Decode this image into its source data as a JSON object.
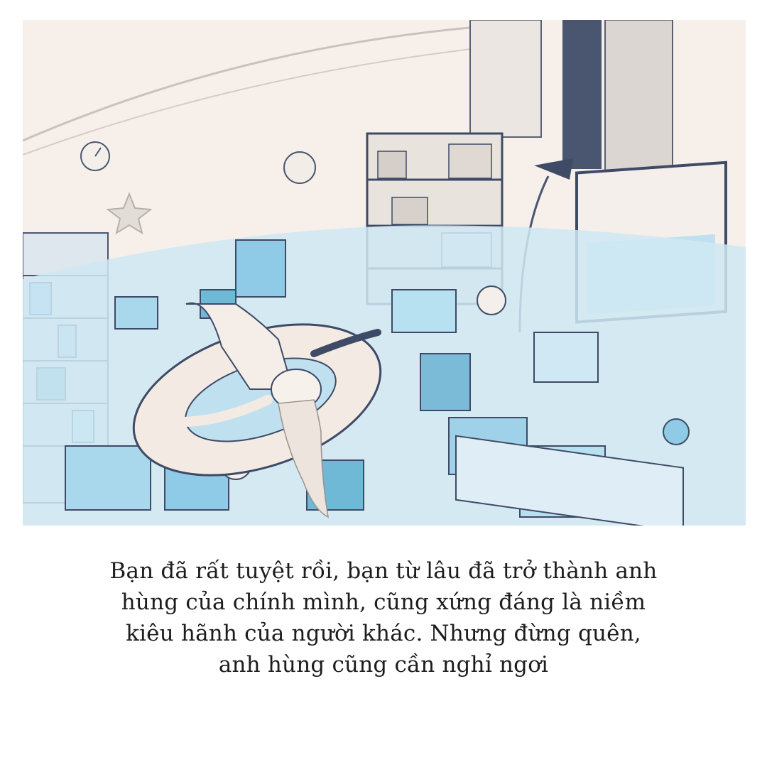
{
  "caption": {
    "lines": [
      "Bạn đã rất tuyệt rồi, bạn từ lâu đã trở thành anh",
      "hùng của chính mình, cũng xứng đáng là niềm",
      "kiêu hãnh của người khác. Nhưng đừng quên,",
      "anh hùng cũng cần nghỉ ngơi"
    ]
  },
  "illustration": {
    "palette": {
      "background": "#f6efe9",
      "water": "#bfe0ee",
      "deep_water": "#6fb8d6",
      "line": "#3e4a66",
      "accent_blue": "#8fcbe6",
      "float_ring": "#f3ebe3"
    }
  }
}
